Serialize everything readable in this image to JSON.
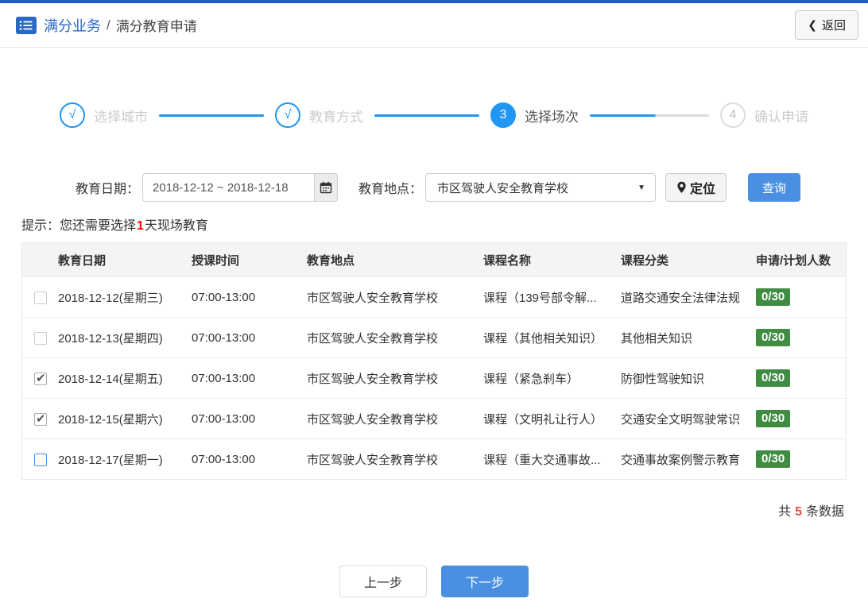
{
  "header": {
    "breadcrumb_primary": "满分业务",
    "breadcrumb_separator": "/",
    "breadcrumb_secondary": "满分教育申请",
    "back_chevron": "❮",
    "back_label": "返回"
  },
  "steps": {
    "items": [
      {
        "marker": "√",
        "label": "选择城市",
        "state": "done"
      },
      {
        "marker": "√",
        "label": "教育方式",
        "state": "done"
      },
      {
        "marker": "3",
        "label": "选择场次",
        "state": "active"
      },
      {
        "marker": "4",
        "label": "确认申请",
        "state": "pending"
      }
    ]
  },
  "filters": {
    "date_label": "教育日期：",
    "date_value": "2018-12-12 ~ 2018-12-18",
    "location_label": "教育地点：",
    "location_value": "市区驾驶人安全教育学校",
    "select_caret": "▼",
    "locate_label": "定位",
    "search_label": "查询"
  },
  "hint": {
    "prefix": "提示：您还需要选择",
    "highlight": "1",
    "suffix": "天现场教育"
  },
  "table": {
    "columns": [
      "教育日期",
      "授课时间",
      "教育地点",
      "课程名称",
      "课程分类",
      "申请/计划人数"
    ],
    "rows": [
      {
        "checkbox_state": "unchecked",
        "date": "2018-12-12(星期三)",
        "time": "07:00-13:00",
        "location": "市区驾驶人安全教育学校",
        "course": "课程（139号部令解...",
        "category": "道路交通安全法律法规",
        "count": "0/30"
      },
      {
        "checkbox_state": "unchecked",
        "date": "2018-12-13(星期四)",
        "time": "07:00-13:00",
        "location": "市区驾驶人安全教育学校",
        "course": "课程（其他相关知识）",
        "category": "其他相关知识",
        "count": "0/30"
      },
      {
        "checkbox_state": "checked",
        "date": "2018-12-14(星期五)",
        "time": "07:00-13:00",
        "location": "市区驾驶人安全教育学校",
        "course": "课程（紧急刹车）",
        "category": "防御性驾驶知识",
        "count": "0/30"
      },
      {
        "checkbox_state": "checked",
        "date": "2018-12-15(星期六)",
        "time": "07:00-13:00",
        "location": "市区驾驶人安全教育学校",
        "course": "课程（文明礼让行人）",
        "category": "交通安全文明驾驶常识",
        "count": "0/30"
      },
      {
        "checkbox_state": "focus",
        "date": "2018-12-17(星期一)",
        "time": "07:00-13:00",
        "location": "市区驾驶人安全教育学校",
        "course": "课程（重大交通事故...",
        "category": "交通事故案例警示教育",
        "count": "0/30"
      }
    ]
  },
  "summary": {
    "prefix": "共",
    "count": "5",
    "suffix": "条数据"
  },
  "footer": {
    "prev_label": "上一步",
    "next_label": "下一步"
  },
  "colors": {
    "top_accent_blue": "#2059c8",
    "brand_blue": "#2a68c5",
    "step_blue": "#2196f3",
    "accent_blue": "#4a90e2",
    "badge_green": "#3f8c42",
    "hint_red": "#ff0000",
    "count_red": "#dd5144"
  }
}
